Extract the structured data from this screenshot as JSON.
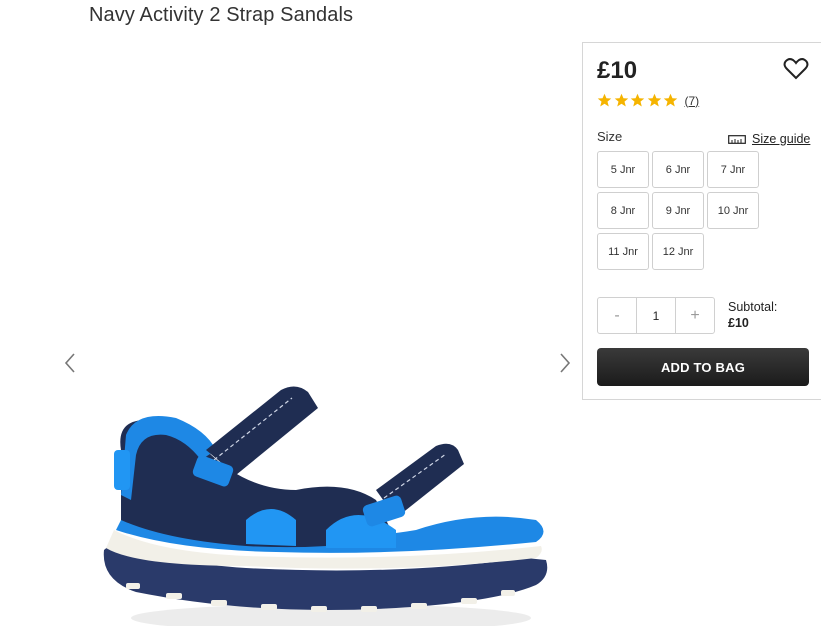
{
  "product": {
    "title": "Navy Activity 2 Strap Sandals"
  },
  "panel": {
    "price": "£10",
    "rating": {
      "stars": 5,
      "count": "(7)"
    },
    "size_label": "Size",
    "size_guide": "Size guide",
    "sizes": [
      "5 Jnr",
      "6 Jnr",
      "7 Jnr",
      "8 Jnr",
      "9 Jnr",
      "10 Jnr",
      "11 Jnr",
      "12 Jnr"
    ],
    "quantity": {
      "minus": "-",
      "value": "1",
      "plus": "+"
    },
    "subtotal_label": "Subtotal:",
    "subtotal_value": "£10",
    "add_to_bag": "ADD TO BAG"
  },
  "icons": {
    "wishlist": "heart-icon",
    "star": "star-icon",
    "size_guide": "ruler-icon",
    "prev": "chevron-left-icon",
    "next": "chevron-right-icon"
  },
  "colors": {
    "star": "#f5b400",
    "button_bg": "#262626",
    "sandal_navy": "#1f2d52",
    "sandal_blue": "#1e88e5"
  }
}
